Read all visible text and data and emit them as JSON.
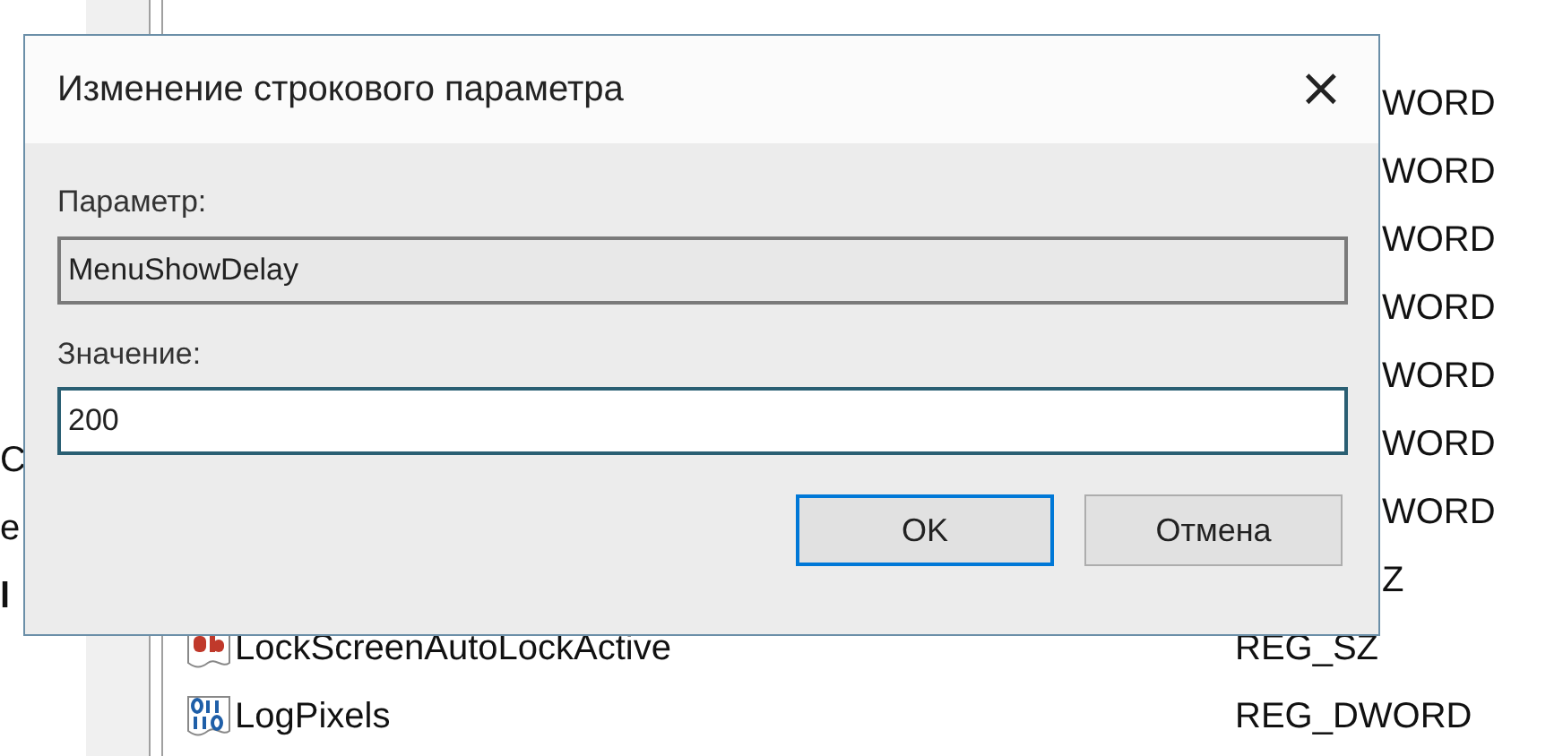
{
  "tree": {
    "items": [
      {
        "label": "C",
        "bold": false
      },
      {
        "label": "e",
        "bold": false
      },
      {
        "label": "l",
        "bold": true
      }
    ]
  },
  "values": [
    {
      "kind": "partial",
      "type": "WORD"
    },
    {
      "kind": "partial",
      "type": "WORD"
    },
    {
      "kind": "partial",
      "type": "WORD"
    },
    {
      "kind": "partial",
      "type": "WORD"
    },
    {
      "kind": "partial",
      "type": "WORD"
    },
    {
      "kind": "partial",
      "type": "WORD"
    },
    {
      "kind": "partial",
      "type": "WORD"
    },
    {
      "kind": "partial",
      "type": "Z"
    },
    {
      "kind": "string",
      "name": "LockScreenAutoLockActive",
      "type": "REG_SZ"
    },
    {
      "kind": "dword",
      "name": "LogPixels",
      "type": "REG_DWORD"
    }
  ],
  "dialog": {
    "title": "Изменение строкового параметра",
    "close": "×",
    "name_label": "Параметр:",
    "name_value": "MenuShowDelay",
    "value_label": "Значение:",
    "value": "200",
    "buttons": [
      {
        "label": "OK",
        "default": true
      },
      {
        "label": "Отмена",
        "default": false
      }
    ]
  }
}
